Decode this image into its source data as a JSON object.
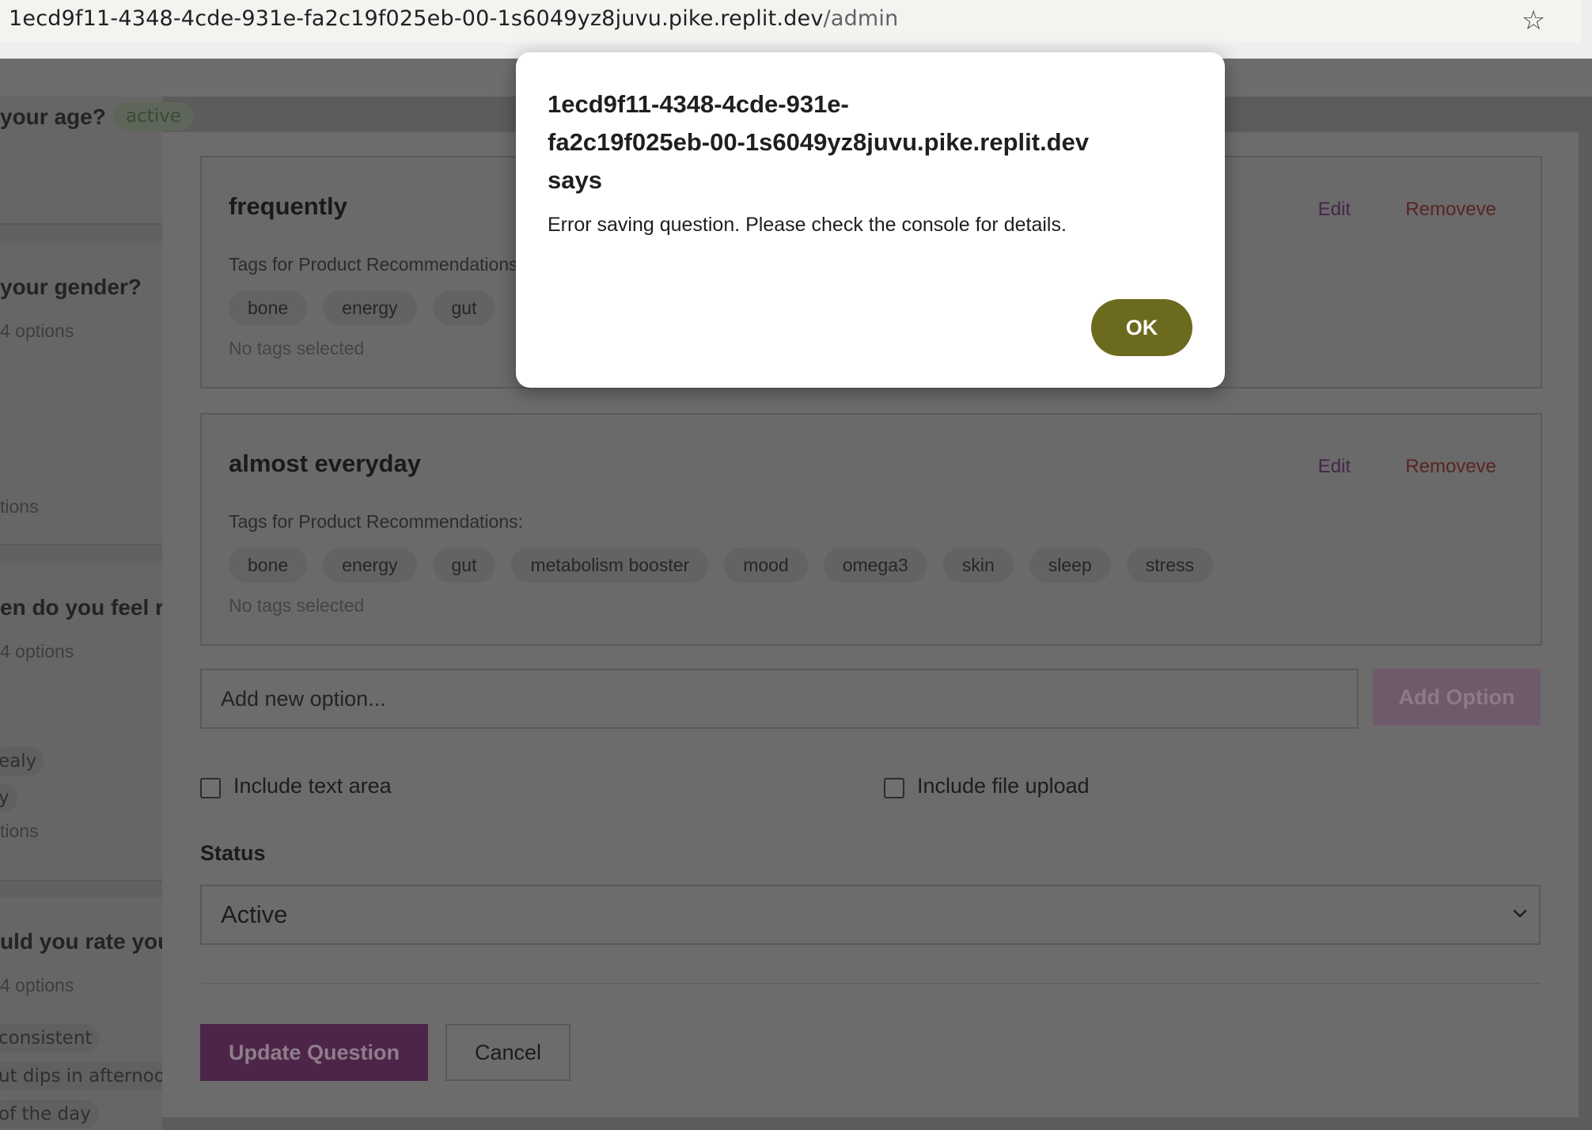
{
  "browser": {
    "url_host": "1ecd9f11-4348-4cde-931e-fa2c19f025eb-00-1s6049yz8juvu.pike.replit.dev",
    "url_path": "/admin",
    "star_icon": "star-icon"
  },
  "background_list": {
    "cards": [
      {
        "title": "your age?",
        "badge": "active"
      },
      {
        "title": "your gender?",
        "meta": "4 options",
        "footer": "tions"
      },
      {
        "title": "en do you feel r",
        "meta": "4 options",
        "pills": [
          "ealy",
          "y"
        ],
        "footer": "tions"
      },
      {
        "title": "uld you rate you",
        "meta": "4 options",
        "pills": [
          "consistent",
          "ut dips in afternoon",
          "of the day"
        ]
      }
    ]
  },
  "modal": {
    "options": [
      {
        "title": "frequently",
        "edit_label": "Edit",
        "remove_label": "Removeve",
        "tags_label": "Tags for Product Recommendations:",
        "tags": [
          "bone",
          "energy",
          "gut"
        ],
        "no_tags": "No tags selected"
      },
      {
        "title": "almost everyday",
        "edit_label": "Edit",
        "remove_label": "Removeve",
        "tags_label": "Tags for Product Recommendations:",
        "tags": [
          "bone",
          "energy",
          "gut",
          "metabolism booster",
          "mood",
          "omega3",
          "skin",
          "sleep",
          "stress"
        ],
        "no_tags": "No tags selected"
      }
    ],
    "new_option_placeholder": "Add new option...",
    "add_option_label": "Add Option",
    "include_text_area_label": "Include text area",
    "include_file_upload_label": "Include file upload",
    "status_label": "Status",
    "status_value": "Active",
    "update_label": "Update Question",
    "cancel_label": "Cancel"
  },
  "alert": {
    "origin": "1ecd9f11-4348-4cde-931e-fa2c19f025eb-00-1s6049yz8juvu.pike.replit.dev says",
    "origin_line1": "1ecd9f11-4348-4cde-931e-",
    "origin_line2": "fa2c19f025eb-00-1s6049yz8juvu.pike.replit.dev",
    "origin_line3": "says",
    "message": "Error saving question. Please check the console for details.",
    "ok_label": "OK"
  },
  "colors": {
    "primary": "#6b2a63",
    "alert_button": "#6c6a1e",
    "danger": "#a52a2a"
  }
}
